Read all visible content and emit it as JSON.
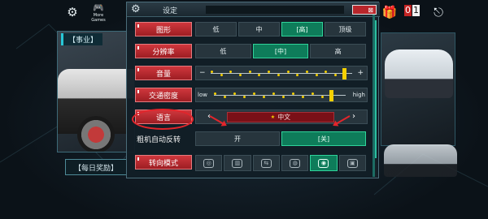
{
  "topbar": {
    "settings_icon": "gear-icon",
    "more_games_icon": "gamepad-icon",
    "more_games_label": "More Games",
    "gift_icon": "gift-icon",
    "counter": "01",
    "exit_icon": "exit-icon"
  },
  "left_panel": {
    "career_tag": "【事业】",
    "daily_reward": "【每日奖励】"
  },
  "dialog": {
    "title": "设定",
    "close_label": "⊠",
    "settings": {
      "graphics": {
        "label": "图形",
        "options": [
          "低",
          "中",
          "[高]",
          "顶级"
        ],
        "selected_index": 2
      },
      "resolution": {
        "label": "分辨率",
        "options": [
          "低",
          "[中]",
          "高"
        ],
        "selected_index": 1
      },
      "volume": {
        "label": "音量",
        "value": 0.93
      },
      "traffic_density": {
        "label": "交通密度",
        "low_label": "low",
        "high_label": "high",
        "value": 0.88
      },
      "language": {
        "label": "语言",
        "value": "中文"
      },
      "coarse_auto_reverse": {
        "label": "粗机自动反转",
        "options": [
          "开",
          "[关]"
        ],
        "selected_index": 1
      },
      "steering_mode": {
        "label": "转向模式",
        "options": [
          "wheel-icon",
          "tilt-icon",
          "arrows-icon",
          "steer-icon",
          "wheel-arrows-icon",
          "buttons-icon"
        ],
        "selected_index": 4
      }
    }
  },
  "colors": {
    "accent_red": "#c42a30",
    "selected_green": "#0e7c5a",
    "slider_yellow": "#f5d000",
    "annotation_red": "#e2252b"
  }
}
